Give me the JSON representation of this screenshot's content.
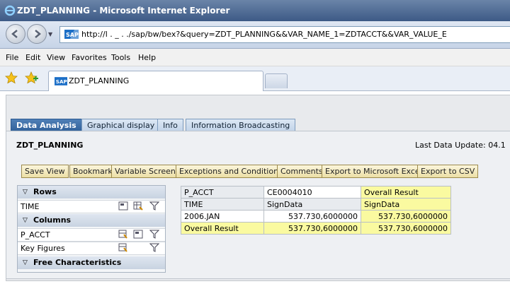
{
  "window": {
    "title": "ZDT_PLANNING - Microsoft Internet Explorer"
  },
  "address": {
    "url": "http://l   .   _  .        ./sap/bw/bex?&query=ZDT_PLANNING&&VAR_NAME_1=ZDTACCT&&VAR_VALUE_E"
  },
  "menu": [
    "File",
    "Edit",
    "View",
    "Favorites",
    "Tools",
    "Help"
  ],
  "browser_tab": {
    "label": "ZDT_PLANNING"
  },
  "main_tabs": [
    "Data Analysis",
    "Graphical display",
    "Info",
    "Information Broadcasting"
  ],
  "report": {
    "title": "ZDT_PLANNING",
    "last_update": "Last Data Update: 04.1"
  },
  "toolbar": [
    "Save View",
    "Bookmark",
    "Variable Screen",
    "Exceptions and Conditions",
    "Comments",
    "Export to Microsoft Excel",
    "Export to CSV"
  ],
  "nav": {
    "rows_header": "Rows",
    "rows": [
      "TIME"
    ],
    "columns_header": "Columns",
    "columns": [
      "P_ACCT",
      "Key Figures"
    ],
    "free_header": "Free Characteristics"
  },
  "grid": {
    "r1": [
      "P_ACCT",
      "CE0004010",
      "Overall Result"
    ],
    "r2": [
      "TIME",
      "SignData",
      "SignData"
    ],
    "r3": [
      "2006.JAN",
      "537.730,6000000",
      "537.730,6000000"
    ],
    "r4": [
      "Overall Result",
      "537.730,6000000",
      "537.730,6000000"
    ]
  },
  "icons": [
    "ie-logo-icon",
    "back-icon",
    "forward-icon",
    "sap-icon",
    "star-icon",
    "add-favorite-icon",
    "table-icon",
    "filter-icon"
  ],
  "colors": {
    "accent": "#2f5f99",
    "highlight": "#fafaa0",
    "button": "#ecdfa6"
  }
}
